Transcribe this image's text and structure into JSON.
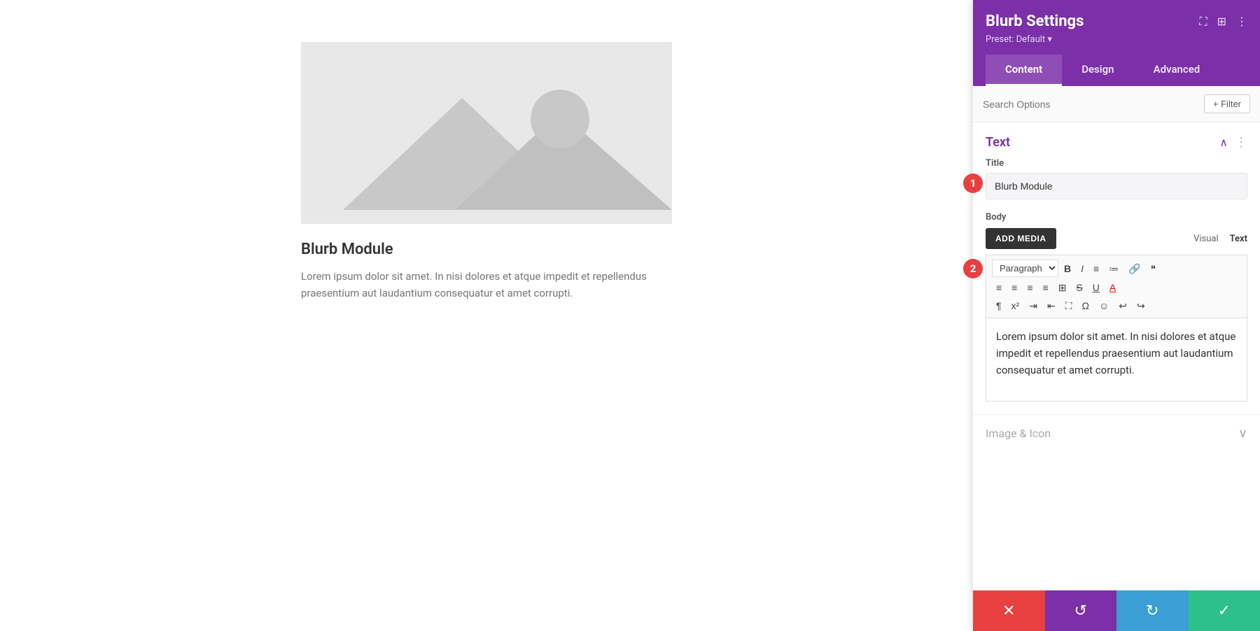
{
  "preview": {
    "title": "Blurb Module",
    "body": "Lorem ipsum dolor sit amet. In nisi dolores et atque impedit et repellendus praesentium aut laudantium consequatur et amet corrupti."
  },
  "panel": {
    "title": "Blurb Settings",
    "preset_label": "Preset: Default ▾",
    "tabs": [
      {
        "id": "content",
        "label": "Content",
        "active": true
      },
      {
        "id": "design",
        "label": "Design",
        "active": false
      },
      {
        "id": "advanced",
        "label": "Advanced",
        "active": false
      }
    ],
    "search_placeholder": "Search Options",
    "filter_label": "+ Filter",
    "sections": {
      "text": {
        "title": "Text",
        "title_field_label": "Title",
        "title_value": "Blurb Module",
        "body_label": "Body",
        "add_media_label": "ADD MEDIA",
        "editor_tab_visual": "Visual",
        "editor_tab_text": "Text",
        "body_content": "Lorem ipsum dolor sit amet. In nisi dolores et atque impedit et repellendus praesentium aut laudantium consequatur et amet corrupti."
      },
      "image_icon": {
        "title": "Image & Icon"
      }
    },
    "footer": {
      "cancel_icon": "✕",
      "undo_icon": "↺",
      "redo_icon": "↻",
      "save_icon": "✓"
    }
  }
}
